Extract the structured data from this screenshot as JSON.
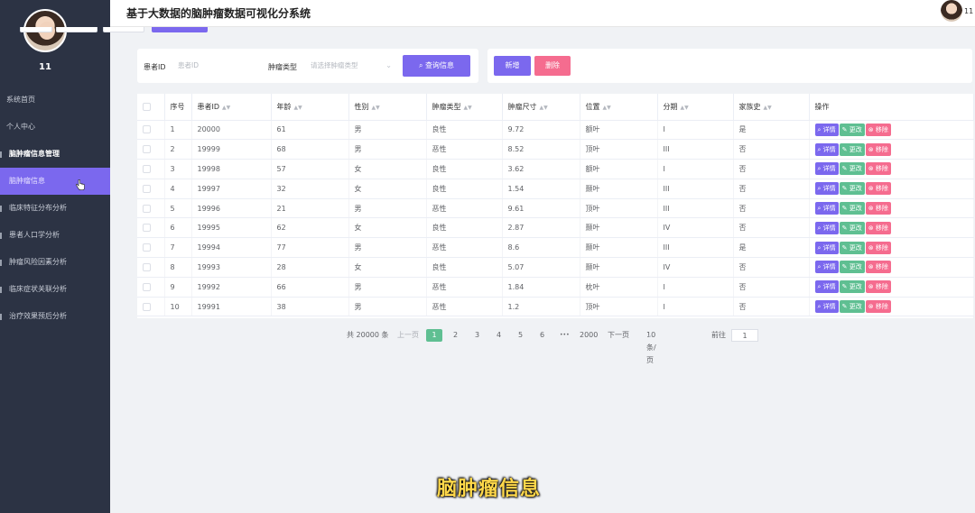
{
  "header": {
    "title": "基于大数据的脑肿瘤数据可视化分系统",
    "user_short": "11"
  },
  "sidebar": {
    "user_name": "11",
    "items": [
      {
        "label": "系统首页"
      },
      {
        "label": "个人中心"
      },
      {
        "label": "脑肿瘤信息管理"
      },
      {
        "label": "脑肿瘤信息"
      },
      {
        "label": "临床特征分布分析"
      },
      {
        "label": "患者人口学分析"
      },
      {
        "label": "肿瘤风险因素分析"
      },
      {
        "label": "临床症状关联分析"
      },
      {
        "label": "治疗效果预后分析"
      }
    ]
  },
  "search": {
    "patient_id_label": "患者ID",
    "patient_id_placeholder": "患者ID",
    "tumor_type_label": "肿瘤类型",
    "tumor_type_placeholder": "请选择肿瘤类型",
    "query_button": "查询信息"
  },
  "actions": {
    "add": "新增",
    "delete": "删除"
  },
  "table": {
    "headers": [
      "序号",
      "患者ID",
      "年龄",
      "性别",
      "肿瘤类型",
      "肿瘤尺寸",
      "位置",
      "分期",
      "家族史",
      "操作"
    ],
    "op_labels": {
      "detail": "详情",
      "edit": "更改",
      "remove": "移除"
    },
    "rows": [
      [
        "1",
        "20000",
        "61",
        "男",
        "良性",
        "9.72",
        "额叶",
        "I",
        "是"
      ],
      [
        "2",
        "19999",
        "68",
        "男",
        "恶性",
        "8.52",
        "顶叶",
        "III",
        "否"
      ],
      [
        "3",
        "19998",
        "57",
        "女",
        "良性",
        "3.62",
        "额叶",
        "I",
        "否"
      ],
      [
        "4",
        "19997",
        "32",
        "女",
        "良性",
        "1.54",
        "颞叶",
        "III",
        "否"
      ],
      [
        "5",
        "19996",
        "21",
        "男",
        "恶性",
        "9.61",
        "顶叶",
        "III",
        "否"
      ],
      [
        "6",
        "19995",
        "62",
        "女",
        "良性",
        "2.87",
        "颞叶",
        "IV",
        "否"
      ],
      [
        "7",
        "19994",
        "77",
        "男",
        "恶性",
        "8.6",
        "颞叶",
        "III",
        "是"
      ],
      [
        "8",
        "19993",
        "28",
        "女",
        "良性",
        "5.07",
        "颞叶",
        "IV",
        "否"
      ],
      [
        "9",
        "19992",
        "66",
        "男",
        "恶性",
        "1.84",
        "枕叶",
        "I",
        "否"
      ],
      [
        "10",
        "19991",
        "38",
        "男",
        "恶性",
        "1.2",
        "顶叶",
        "I",
        "否"
      ]
    ]
  },
  "pagination": {
    "total": "共 20000 条",
    "prev": "上一页",
    "pages": [
      "1",
      "2",
      "3",
      "4",
      "5",
      "6"
    ],
    "ellipsis": "•••",
    "last": "2000",
    "next": "下一页",
    "page_size": "10条/页",
    "goto_label": "前往",
    "goto_value": "1"
  },
  "caption": "脑肿瘤信息",
  "colors": {
    "sidebar_bg": "#2c3344",
    "accent": "#7b68ee",
    "danger": "#f56c8f",
    "success": "#5fbf92"
  }
}
